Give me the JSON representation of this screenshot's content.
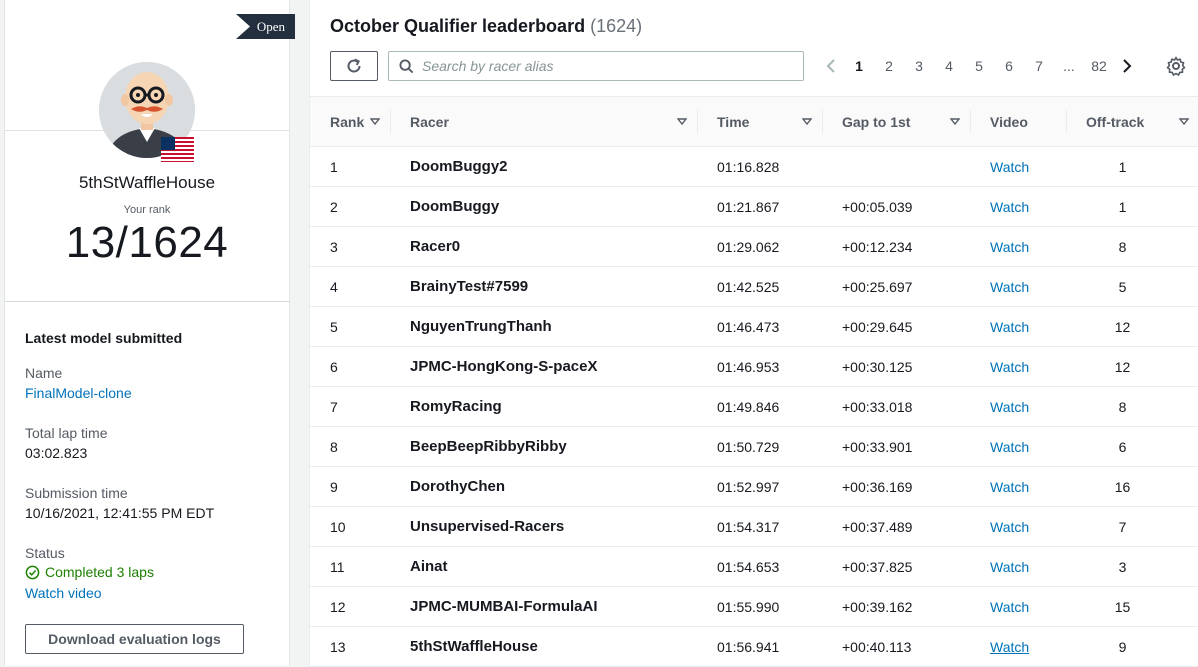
{
  "profile": {
    "status_tag": "Open",
    "racer_name": "5thStWaffleHouse",
    "rank_label": "Your rank",
    "rank_value": "13/1624"
  },
  "model": {
    "title": "Latest model submitted",
    "name_label": "Name",
    "name_value": "FinalModel-clone",
    "lap_label": "Total lap time",
    "lap_value": "03:02.823",
    "submission_label": "Submission time",
    "submission_value": "10/16/2021, 12:41:55 PM EDT",
    "status_label": "Status",
    "status_value": "Completed 3 laps",
    "watch_video": "Watch video",
    "download_button": "Download evaluation logs"
  },
  "leaderboard": {
    "title": "October Qualifier leaderboard",
    "count": "(1624)",
    "search_placeholder": "Search by racer alias",
    "pages": [
      "1",
      "2",
      "3",
      "4",
      "5",
      "6",
      "7",
      "...",
      "82"
    ],
    "current_page": "1",
    "columns": [
      "Rank",
      "Racer",
      "Time",
      "Gap to 1st",
      "Video",
      "Off-track"
    ],
    "rows": [
      {
        "rank": "1",
        "racer": "DoomBuggy2",
        "time": "01:16.828",
        "gap": "",
        "video": "Watch",
        "offtrack": "1"
      },
      {
        "rank": "2",
        "racer": "DoomBuggy",
        "time": "01:21.867",
        "gap": "+00:05.039",
        "video": "Watch",
        "offtrack": "1"
      },
      {
        "rank": "3",
        "racer": "Racer0",
        "time": "01:29.062",
        "gap": "+00:12.234",
        "video": "Watch",
        "offtrack": "8"
      },
      {
        "rank": "4",
        "racer": "BrainyTest#7599",
        "time": "01:42.525",
        "gap": "+00:25.697",
        "video": "Watch",
        "offtrack": "5"
      },
      {
        "rank": "5",
        "racer": "NguyenTrungThanh",
        "time": "01:46.473",
        "gap": "+00:29.645",
        "video": "Watch",
        "offtrack": "12"
      },
      {
        "rank": "6",
        "racer": "JPMC-HongKong-S-paceX",
        "time": "01:46.953",
        "gap": "+00:30.125",
        "video": "Watch",
        "offtrack": "12"
      },
      {
        "rank": "7",
        "racer": "RomyRacing",
        "time": "01:49.846",
        "gap": "+00:33.018",
        "video": "Watch",
        "offtrack": "8"
      },
      {
        "rank": "8",
        "racer": "BeepBeepRibbyRibby",
        "time": "01:50.729",
        "gap": "+00:33.901",
        "video": "Watch",
        "offtrack": "6"
      },
      {
        "rank": "9",
        "racer": "DorothyChen",
        "time": "01:52.997",
        "gap": "+00:36.169",
        "video": "Watch",
        "offtrack": "16"
      },
      {
        "rank": "10",
        "racer": "Unsupervised-Racers",
        "time": "01:54.317",
        "gap": "+00:37.489",
        "video": "Watch",
        "offtrack": "7"
      },
      {
        "rank": "11",
        "racer": "Ainat",
        "time": "01:54.653",
        "gap": "+00:37.825",
        "video": "Watch",
        "offtrack": "3"
      },
      {
        "rank": "12",
        "racer": "JPMC-MUMBAI-FormulaAI",
        "time": "01:55.990",
        "gap": "+00:39.162",
        "video": "Watch",
        "offtrack": "15"
      },
      {
        "rank": "13",
        "racer": "5thStWaffleHouse",
        "time": "01:56.941",
        "gap": "+00:40.113",
        "video": "Watch",
        "offtrack": "9"
      }
    ]
  },
  "icons": {
    "refresh": "refresh-icon",
    "search": "search-icon",
    "prev": "chevron-left-icon",
    "next": "chevron-right-icon",
    "settings": "gear-icon",
    "sort": "caret-down-icon",
    "status": "check-circle-icon"
  },
  "colors": {
    "link": "#0073bb",
    "success": "#1d8102",
    "tag": "#232f3e"
  }
}
